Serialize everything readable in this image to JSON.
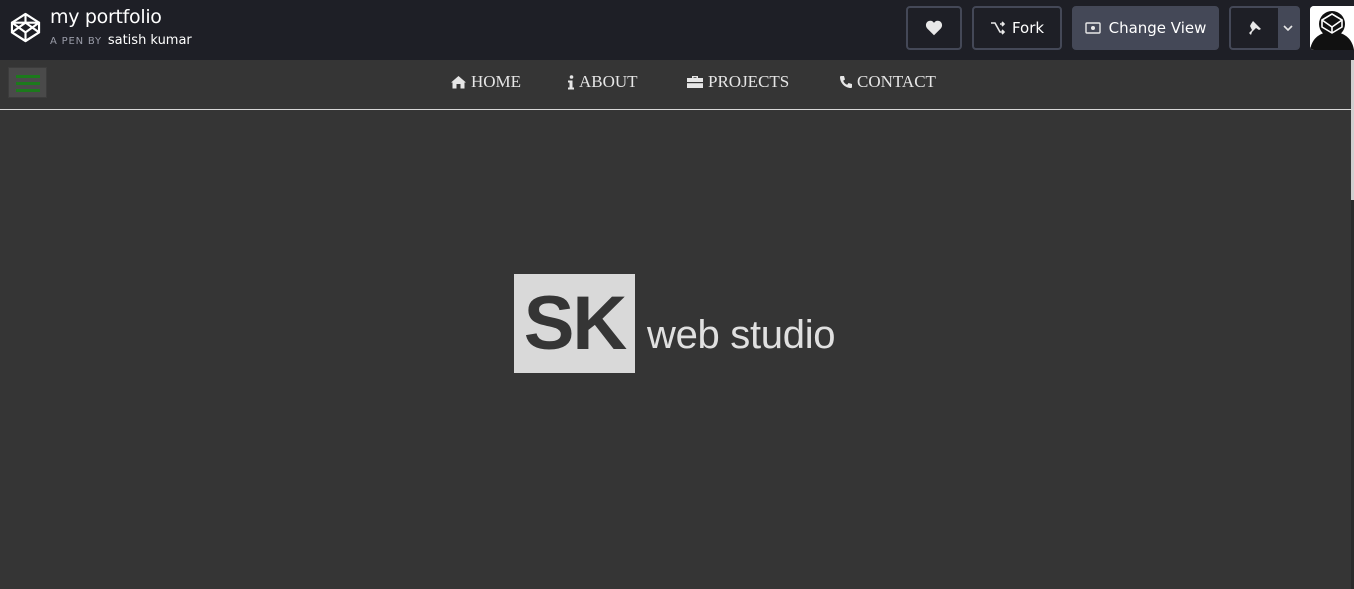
{
  "codepen": {
    "pen_title": "my portfolio",
    "pen_by_label": "A PEN BY",
    "author": "satish kumar",
    "fork_label": "Fork",
    "change_view_label": "Change View"
  },
  "nav": {
    "items": [
      {
        "label": "HOME",
        "icon": "home-icon"
      },
      {
        "label": "ABOUT",
        "icon": "info-icon"
      },
      {
        "label": "PROJECTS",
        "icon": "briefcase-icon"
      },
      {
        "label": "CONTACT",
        "icon": "phone-icon"
      }
    ]
  },
  "hero": {
    "logo_mark": "SK",
    "logo_text": "web studio"
  },
  "colors": {
    "topbar": "#1e1f26",
    "page_bg": "#353535",
    "hamburger_lines": "#1c7a1c",
    "logo_box": "#d9d9d9"
  }
}
